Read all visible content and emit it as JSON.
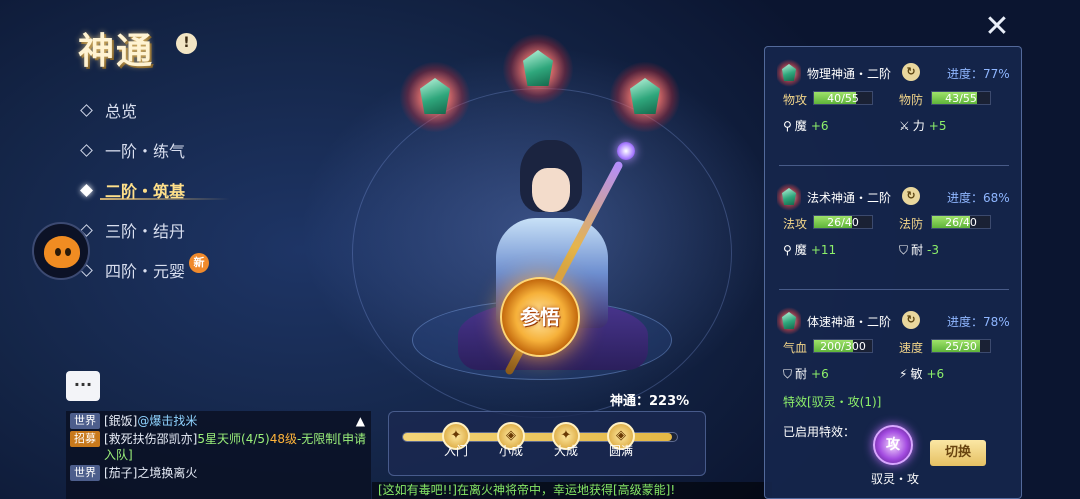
{
  "header": {
    "title": "神通",
    "info_icon": "!",
    "close_icon": "✕"
  },
  "tree": [
    {
      "label": "总览",
      "active": false
    },
    {
      "label": "一阶・练气",
      "active": false
    },
    {
      "label": "二阶・筑基",
      "active": true
    },
    {
      "label": "三阶・结丹",
      "active": false
    },
    {
      "label": "四阶・元婴",
      "active": false,
      "badge": "新"
    }
  ],
  "center": {
    "meditate_label": "参悟",
    "power_label": "神通：223%",
    "progress_fraction": 0.98,
    "nodes": [
      {
        "label": "入门",
        "icon": "key-icon"
      },
      {
        "label": "小成",
        "icon": "shield-icon"
      },
      {
        "label": "大成",
        "icon": "key-icon"
      },
      {
        "label": "圆满",
        "icon": "shield-icon"
      }
    ]
  },
  "chat": {
    "collapse_icon": "▲",
    "lines": [
      {
        "channel": "世界",
        "parts": [
          "[鈱饭]",
          "@爆击找米"
        ]
      },
      {
        "channel": "招募",
        "parts": [
          "[救死扶伤邵凯亦]",
          "5星天师(4/5)",
          "48级",
          "-无限制[申请入队]"
        ]
      },
      {
        "channel": "世界",
        "parts": [
          "[茄子]",
          "之境换离火"
        ]
      }
    ]
  },
  "ticker": "[这如有毒吧!!]在离火神将帝中，幸运地获得[高级蒙能]!",
  "panel": {
    "sections": [
      {
        "name": "物理神通・二阶",
        "progress_label": "进度：",
        "progress": "77%",
        "stats": [
          {
            "label": "物攻",
            "current": 40,
            "max": 55,
            "text": "40/55"
          },
          {
            "label": "物防",
            "current": 43,
            "max": 55,
            "text": "43/55"
          }
        ],
        "bonuses": [
          {
            "icon": "key-icon",
            "name": "魔",
            "value": "+6"
          },
          {
            "icon": "sword-icon",
            "name": "力",
            "value": "+5"
          }
        ]
      },
      {
        "name": "法术神通・二阶",
        "progress_label": "进度：",
        "progress": "68%",
        "stats": [
          {
            "label": "法攻",
            "current": 26,
            "max": 40,
            "text": "26/40"
          },
          {
            "label": "法防",
            "current": 26,
            "max": 40,
            "text": "26/40"
          }
        ],
        "bonuses": [
          {
            "icon": "key-icon",
            "name": "魔",
            "value": "+11"
          },
          {
            "icon": "shield-icon",
            "name": "耐",
            "value": "-3"
          }
        ]
      },
      {
        "name": "体速神通・二阶",
        "progress_label": "进度：",
        "progress": "78%",
        "stats": [
          {
            "label": "气血",
            "current": 200,
            "max": 300,
            "text": "200/300"
          },
          {
            "label": "速度",
            "current": 25,
            "max": 30,
            "text": "25/30"
          }
        ],
        "bonuses": [
          {
            "icon": "shield-icon",
            "name": "耐",
            "value": "+6"
          },
          {
            "icon": "boot-icon",
            "name": "敏",
            "value": "+6"
          }
        ],
        "effect": "特效[驭灵・攻(1)]"
      }
    ],
    "enabled_label": "已启用特效：",
    "skill_glyph": "攻",
    "skill_name": "驭灵・攻",
    "switch_label": "切换"
  }
}
